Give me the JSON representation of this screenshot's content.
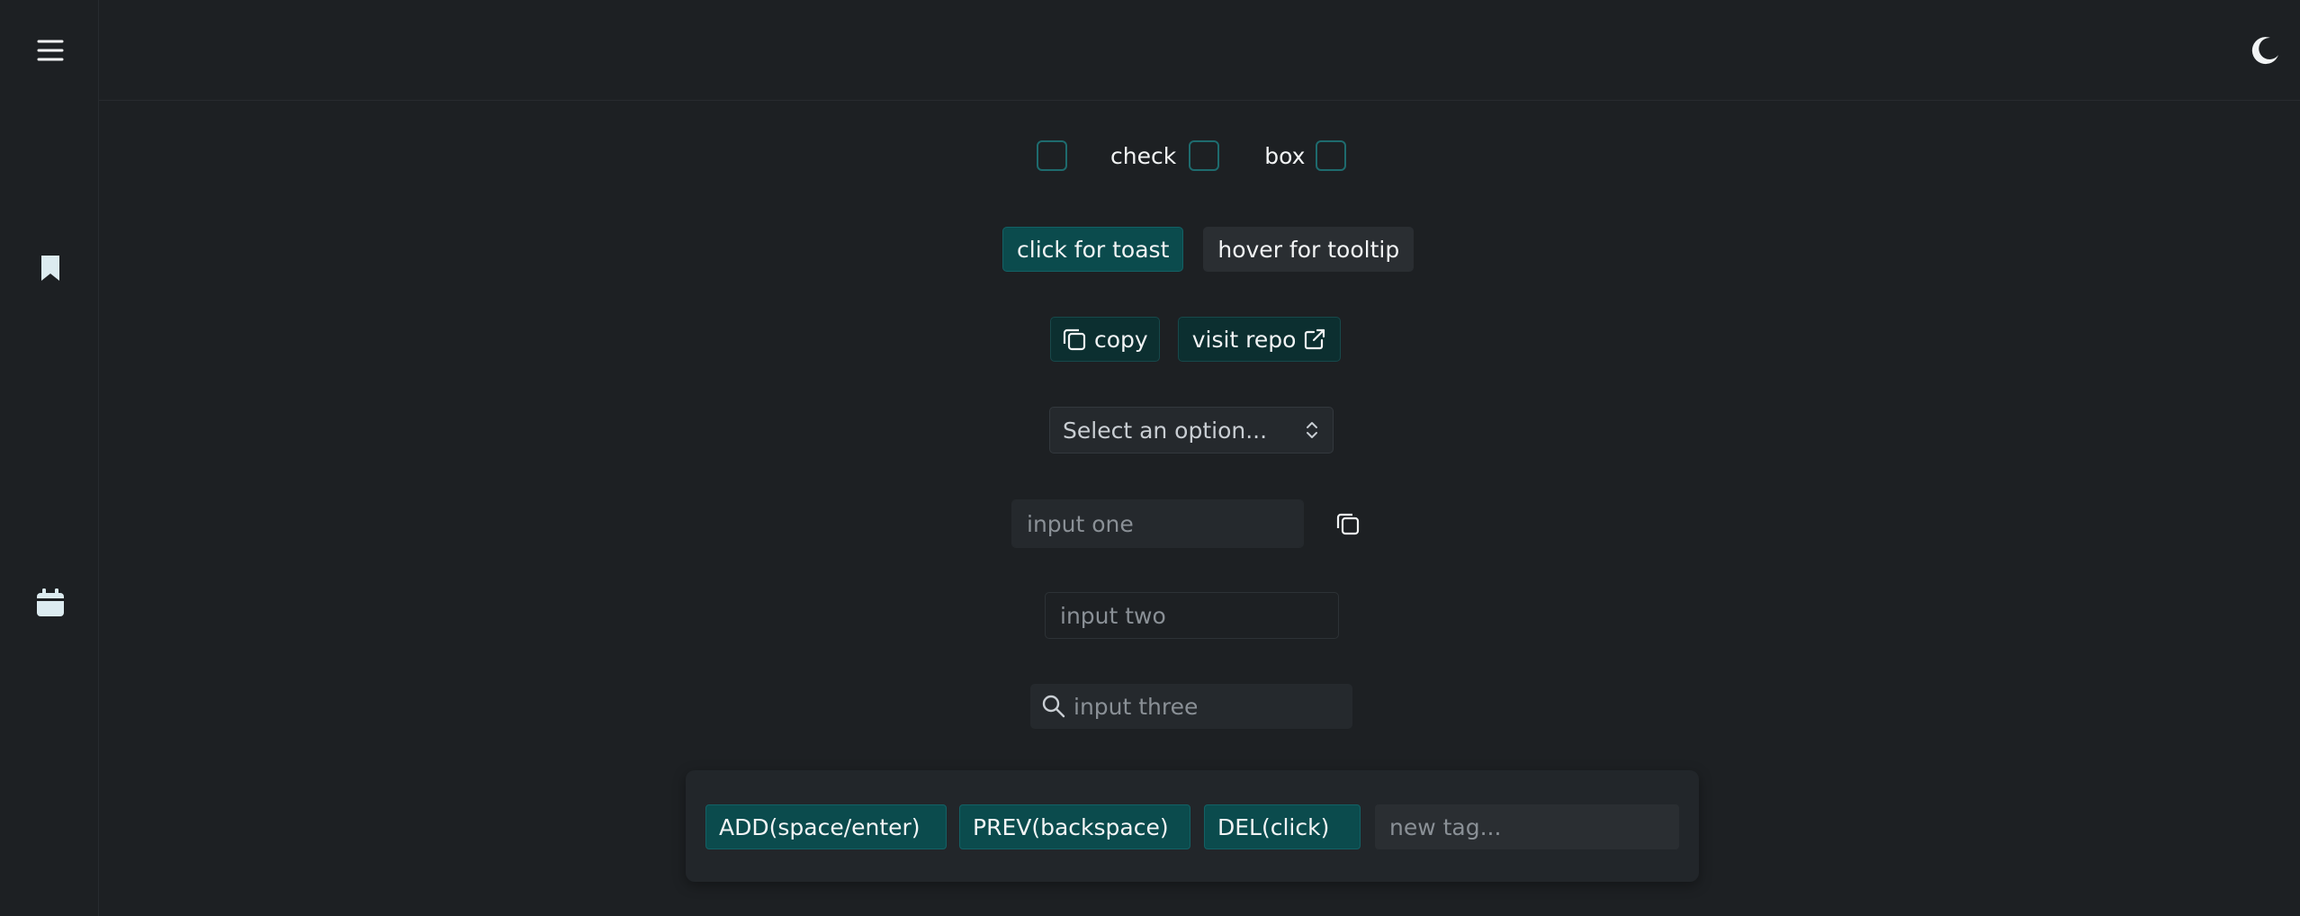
{
  "nav": {
    "menu_icon": "menu-icon",
    "bookmark_icon": "bookmark-icon",
    "calendar_icon": "calendar-icon",
    "theme_icon": "moon-icon"
  },
  "checkboxes": {
    "label_check": "check",
    "label_box": "box"
  },
  "buttons": {
    "toast": "click for toast",
    "tooltip": "hover for tooltip",
    "copy": "copy",
    "visit_repo": "visit repo"
  },
  "select": {
    "value": "Select an option..."
  },
  "inputs": {
    "one_placeholder": "input one",
    "two_placeholder": "input two",
    "three_placeholder": "input three"
  },
  "tags": {
    "items": [
      "ADD(space/enter)",
      "PREV(backspace)",
      "DEL(click)"
    ],
    "new_placeholder": "new tag..."
  },
  "colors": {
    "background": "#1d2023",
    "accent": "#0b4b4d",
    "checkbox_border": "#1e6b6e"
  }
}
